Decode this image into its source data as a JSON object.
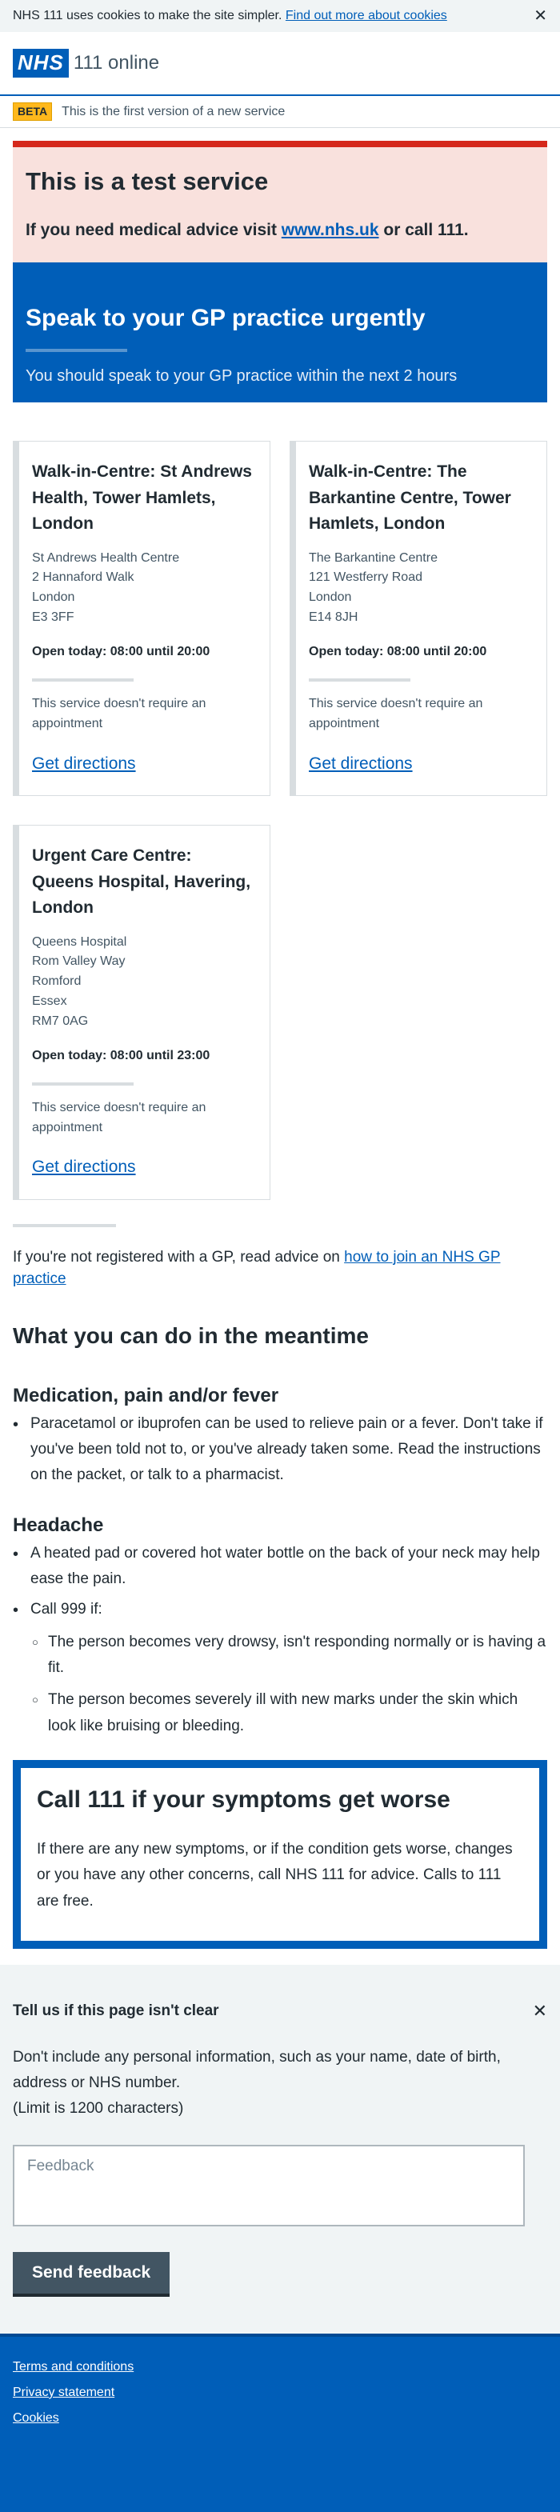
{
  "cookie_banner": {
    "text": "NHS 111 uses cookies to make the site simpler.",
    "link": "Find out more about cookies",
    "close_icon": "close-icon"
  },
  "header": {
    "logo": "NHS",
    "service_name": "111 online"
  },
  "beta": {
    "tag": "BETA",
    "text": "This is the first version of a new service"
  },
  "test_service": {
    "title": "This is a test service",
    "text_before": "If you need medical advice visit ",
    "link": "www.nhs.uk",
    "text_after": " or call 111."
  },
  "hero": {
    "title": "Speak to your GP practice urgently",
    "subtitle": "You should speak to your GP practice within the next 2 hours"
  },
  "services": [
    {
      "name": "Walk-in-Centre: St Andrews Health, Tower Hamlets, London",
      "address": [
        "St Andrews Health Centre",
        "2 Hannaford Walk",
        "London",
        "E3 3FF"
      ],
      "opening": "Open today: 08:00 until 20:00",
      "note": "This service doesn't require an appointment",
      "link": "Get directions"
    },
    {
      "name": "Walk-in-Centre: The Barkantine Centre, Tower Hamlets, London",
      "address": [
        "The Barkantine Centre",
        "121 Westferry Road",
        "London",
        "E14 8JH"
      ],
      "opening": "Open today: 08:00 until 20:00",
      "note": "This service doesn't require an appointment",
      "link": "Get directions"
    },
    {
      "name": "Urgent Care Centre: Queens Hospital, Havering, London",
      "address": [
        "Queens Hospital",
        "Rom Valley Way",
        "Romford",
        "Essex",
        "RM7 0AG"
      ],
      "opening": "Open today: 08:00 until 23:00",
      "note": "This service doesn't require an appointment",
      "link": "Get directions"
    }
  ],
  "gp_registration": {
    "text": "If you're not registered with a GP, read advice on ",
    "link": "how to join an NHS GP practice"
  },
  "meantime": {
    "title": "What you can do in the meantime",
    "medication": {
      "title": "Medication, pain and/or fever",
      "items": [
        "Paracetamol or ibuprofen can be used to relieve pain or a fever. Don't take if you've been told not to, or you've already taken some. Read the instructions on the packet, or talk to a pharmacist."
      ]
    },
    "headache": {
      "title": "Headache",
      "item1": "A heated pad or covered hot water bottle on the back of your neck may help ease the pain.",
      "item2": "Call 999 if:",
      "subitems": [
        "The person becomes very drowsy, isn't responding normally or is having a fit.",
        "The person becomes severely ill with new marks under the skin which look like bruising or bleeding."
      ]
    }
  },
  "care_card": {
    "title": "Call 111 if your symptoms get worse",
    "text": "If there are any new symptoms, or if the condition gets worse, changes or you have any other concerns, call NHS 111 for advice. Calls to 111 are free."
  },
  "feedback": {
    "title": "Tell us if this page isn't clear",
    "close_icon": "close-icon",
    "text": "Don't include any personal information, such as your name, date of birth, address or NHS number.",
    "limit": "(Limit is 1200 characters)",
    "placeholder": "Feedback",
    "button": "Send feedback"
  },
  "footer": {
    "links": [
      "Terms and conditions",
      "Privacy statement",
      "Cookies"
    ]
  }
}
